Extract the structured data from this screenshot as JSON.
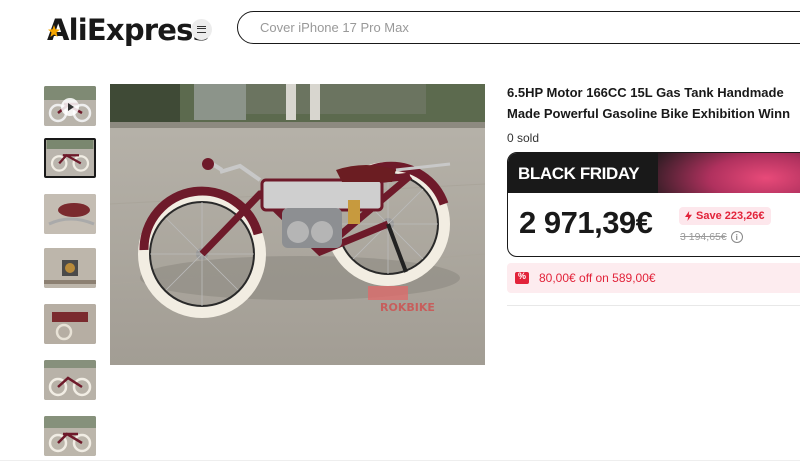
{
  "header": {
    "logo_text": "AliExpress",
    "search_placeholder": "Cover iPhone 17 Pro Max"
  },
  "gallery": {
    "thumbnails": [
      {
        "kind": "video"
      },
      {
        "kind": "image",
        "active": true
      },
      {
        "kind": "image"
      },
      {
        "kind": "image"
      },
      {
        "kind": "image"
      },
      {
        "kind": "image"
      },
      {
        "kind": "image"
      }
    ],
    "main_image_watermark": "ROKBIKE"
  },
  "product": {
    "title_line1": "6.5HP Motor 166CC 15L Gas Tank Handmade",
    "title_line2": "Made Powerful Gasoline Bike Exhibition Winn",
    "sold": "0 sold"
  },
  "price": {
    "promo_label": "BLACK FRIDAY",
    "current": "2 971,39€",
    "save": "Save 223,26€",
    "original": "3 194,65€",
    "info_icon": "i"
  },
  "coupon": {
    "text": "80,00€ off on 589,00€"
  },
  "colors": {
    "accent_red": "#e2233a",
    "promo_bg": "#191919",
    "coupon_bg": "#fdecef",
    "bike_frame": "#6e1a2a"
  }
}
